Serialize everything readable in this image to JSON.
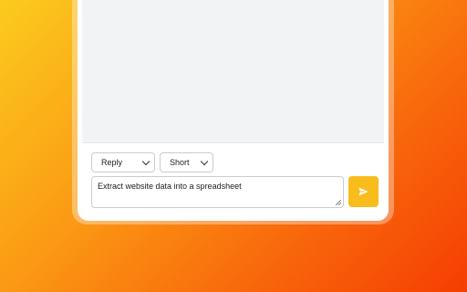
{
  "composer": {
    "mode_select": {
      "value": "Reply"
    },
    "length_select": {
      "value": "Short"
    },
    "prompt_input": {
      "value": "Extract website data into a spreadsheet"
    },
    "send_button": {
      "icon": "send-icon"
    }
  },
  "colors": {
    "accent": "#f8bd1d",
    "chat_background": "#f2f3f5",
    "gradient_start": "#fbcb1e",
    "gradient_end": "#f53e02"
  }
}
